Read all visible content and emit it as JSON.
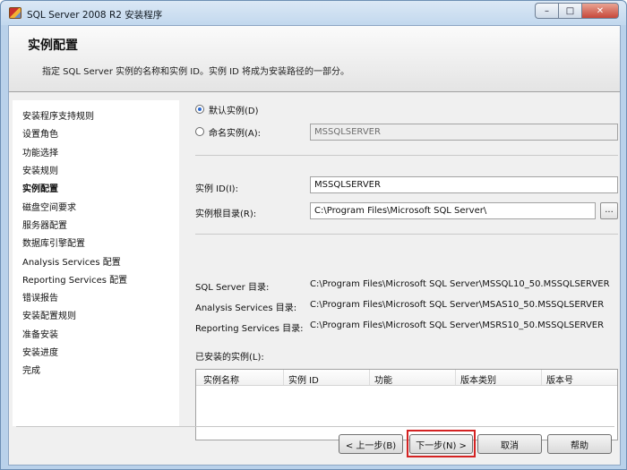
{
  "window": {
    "title": "SQL Server 2008 R2 安装程序",
    "min": "–",
    "max": "□",
    "close": "✕"
  },
  "header": {
    "title": "实例配置",
    "description": "指定 SQL Server 实例的名称和实例 ID。实例 ID 将成为安装路径的一部分。"
  },
  "nav": {
    "items": [
      "安装程序支持规则",
      "设置角色",
      "功能选择",
      "安装规则",
      "实例配置",
      "磁盘空间要求",
      "服务器配置",
      "数据库引擎配置",
      "Analysis Services 配置",
      "Reporting Services 配置",
      "错误报告",
      "安装配置规则",
      "准备安装",
      "安装进度",
      "完成"
    ],
    "active_index": 4
  },
  "instance": {
    "default_label": "默认实例(D)",
    "named_label": "命名实例(A):",
    "named_value": "MSSQLSERVER",
    "id_label": "实例 ID(I):",
    "id_value": "MSSQLSERVER",
    "root_label": "实例根目录(R):",
    "root_value": "C:\\Program Files\\Microsoft SQL Server\\",
    "browse": "..."
  },
  "dirs": {
    "sql_label": "SQL Server 目录:",
    "sql_value": "C:\\Program Files\\Microsoft SQL Server\\MSSQL10_50.MSSQLSERVER",
    "as_label": "Analysis Services 目录:",
    "as_value": "C:\\Program Files\\Microsoft SQL Server\\MSAS10_50.MSSQLSERVER",
    "rs_label": "Reporting Services 目录:",
    "rs_value": "C:\\Program Files\\Microsoft SQL Server\\MSRS10_50.MSSQLSERVER"
  },
  "installed": {
    "label": "已安装的实例(L):",
    "columns": [
      "实例名称",
      "实例 ID",
      "功能",
      "版本类别",
      "版本号"
    ]
  },
  "buttons": {
    "back": "< 上一步(B)",
    "next": "下一步(N) >",
    "cancel": "取消",
    "help": "帮助"
  }
}
